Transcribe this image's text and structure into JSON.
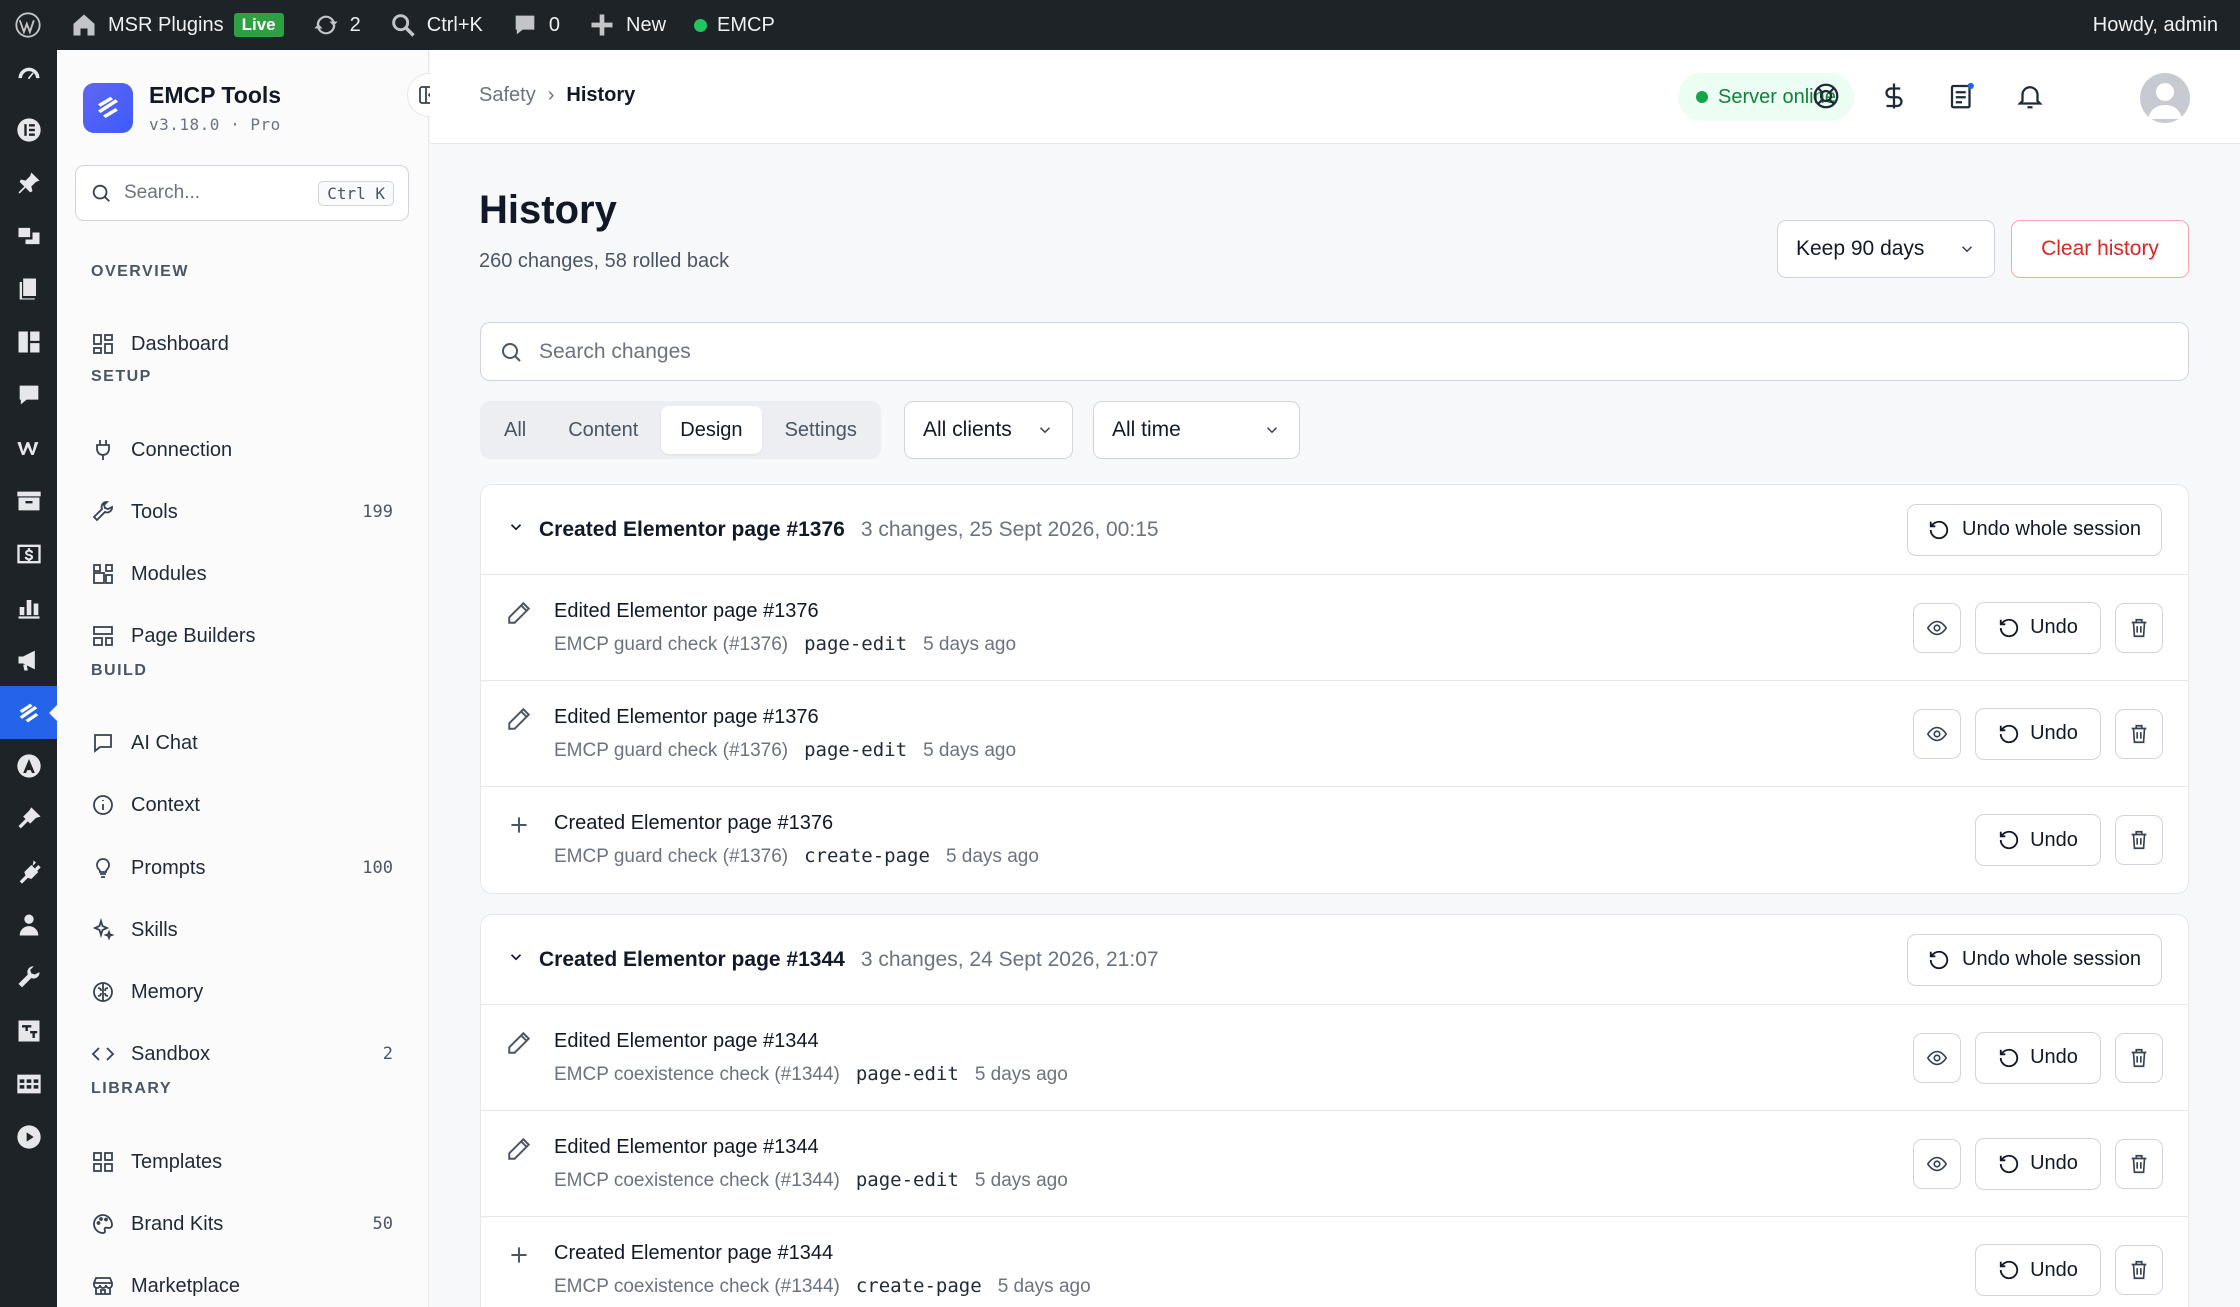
{
  "adminbar": {
    "site_name": "MSR Plugins",
    "live_label": "Live",
    "updates_count": "2",
    "search_shortcut": "Ctrl+K",
    "comments_count": "0",
    "new_label": "New",
    "plugin_label": "EMCP",
    "howdy": "Howdy, admin"
  },
  "sidebar": {
    "brand_title": "EMCP Tools",
    "brand_version": "v3.18.0 · Pro",
    "search_placeholder": "Search...",
    "search_kbd": "Ctrl K",
    "sections": {
      "overview": "OVERVIEW",
      "setup": "SETUP",
      "build": "BUILD",
      "library": "LIBRARY"
    },
    "items": {
      "dashboard": "Dashboard",
      "connection": "Connection",
      "tools": "Tools",
      "tools_count": "199",
      "modules": "Modules",
      "page_builders": "Page Builders",
      "ai_chat": "AI Chat",
      "context": "Context",
      "prompts": "Prompts",
      "prompts_count": "100",
      "skills": "Skills",
      "memory": "Memory",
      "sandbox": "Sandbox",
      "sandbox_count": "2",
      "templates": "Templates",
      "brand_kits": "Brand Kits",
      "brand_kits_count": "50",
      "marketplace": "Marketplace"
    }
  },
  "topbar": {
    "breadcrumb_parent": "Safety",
    "breadcrumb_sep": "›",
    "breadcrumb_current": "History",
    "server_status": "Server online"
  },
  "main": {
    "title": "History",
    "subtitle": "260 changes, 58 rolled back",
    "retention": "Keep 90 days",
    "clear_label": "Clear history",
    "search_placeholder": "Search changes",
    "filters": [
      "All",
      "Content",
      "Design",
      "Settings"
    ],
    "active_filter": "Design",
    "clients": "All clients",
    "time": "All time",
    "undo_session_label": "Undo whole session",
    "undo_label": "Undo",
    "sessions": [
      {
        "title": "Created Elementor page #1376",
        "meta": "3 changes, 25 Sept 2026, 00:15",
        "rows": [
          {
            "title": "Edited Elementor page #1376",
            "source": "EMCP guard check (#1376)",
            "code": "page-edit",
            "time": "5 days ago"
          },
          {
            "title": "Edited Elementor page #1376",
            "source": "EMCP guard check (#1376)",
            "code": "page-edit",
            "time": "5 days ago"
          },
          {
            "title": "Created Elementor page #1376",
            "source": "EMCP guard check (#1376)",
            "code": "create-page",
            "time": "5 days ago"
          }
        ]
      },
      {
        "title": "Created Elementor page #1344",
        "meta": "3 changes, 24 Sept 2026, 21:07",
        "rows": [
          {
            "title": "Edited Elementor page #1344",
            "source": "EMCP coexistence check (#1344)",
            "code": "page-edit",
            "time": "5 days ago"
          },
          {
            "title": "Edited Elementor page #1344",
            "source": "EMCP coexistence check (#1344)",
            "code": "page-edit",
            "time": "5 days ago"
          },
          {
            "title": "Created Elementor page #1344",
            "source": "EMCP coexistence check (#1344)",
            "code": "create-page",
            "time": "5 days ago"
          }
        ]
      }
    ]
  }
}
